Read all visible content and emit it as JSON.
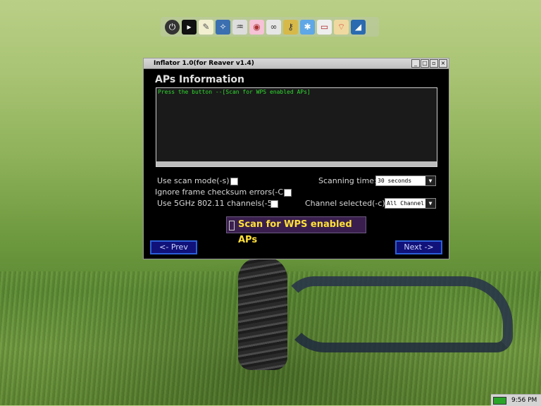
{
  "dock": {
    "icons": [
      "power-icon",
      "terminal-icon",
      "text-editor-icon",
      "tools-icon",
      "audio-icon",
      "media-icon",
      "network-manager-icon",
      "key-icon",
      "bluetooth-icon",
      "display-icon",
      "wifi-icon",
      "wireshark-icon"
    ]
  },
  "window": {
    "title": "Inflator 1.0(for Reaver v1.4)",
    "section_title": "APs Information",
    "log_text": "Press the button --[Scan for WPS enabled APs]",
    "options": {
      "scan_mode_label": "Use scan mode(-s)",
      "ignore_checksum_label": "Ignore frame checksum errors(-C)",
      "use_5ghz_label": "Use 5GHz 802.11 channels(-5)"
    },
    "scanning_time": {
      "label": "Scanning time:",
      "value": "30 seconds"
    },
    "channel": {
      "label": "Channel selected(-c):",
      "value": "All Channel"
    },
    "scan_button_label": "Scan for WPS enabled APs",
    "prev_label": "<- Prev",
    "next_label": "Next ->"
  },
  "tray": {
    "clock": "9:56 PM"
  },
  "colors": {
    "log_text": "#2fdc2f",
    "scan_button_text": "#ffe03a",
    "nav_button_bg": "#11117a"
  }
}
